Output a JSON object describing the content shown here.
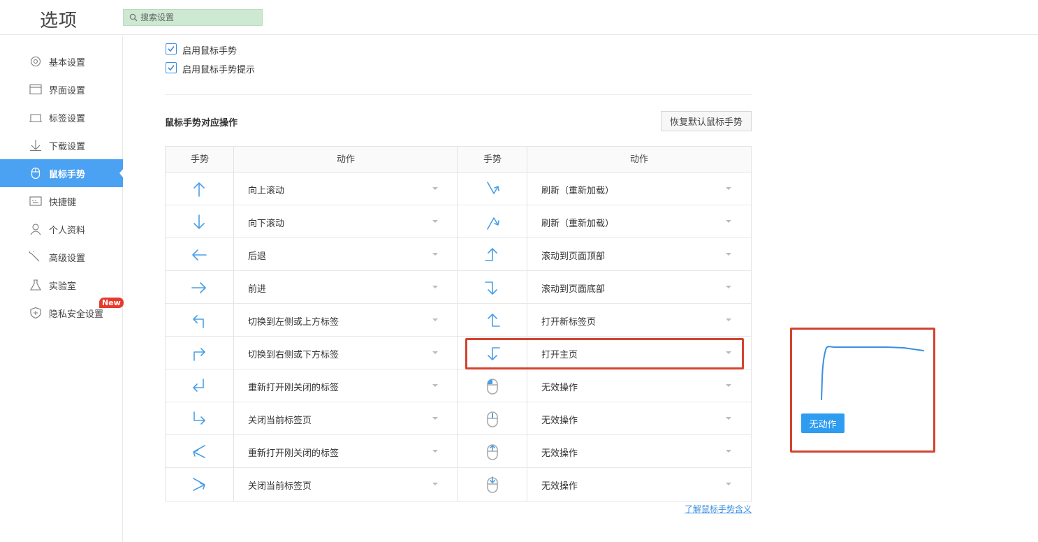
{
  "header": {
    "title": "选项",
    "search_placeholder": "搜索设置"
  },
  "sidebar": {
    "items": [
      {
        "label": "基本设置",
        "icon": "gear-icon"
      },
      {
        "label": "界面设置",
        "icon": "window-icon"
      },
      {
        "label": "标签设置",
        "icon": "tab-icon"
      },
      {
        "label": "下载设置",
        "icon": "download-icon"
      },
      {
        "label": "鼠标手势",
        "icon": "mouse-icon",
        "active": true
      },
      {
        "label": "快捷键",
        "icon": "keyboard-icon"
      },
      {
        "label": "个人资料",
        "icon": "user-icon"
      },
      {
        "label": "高级设置",
        "icon": "wrench-icon"
      },
      {
        "label": "实验室",
        "icon": "flask-icon"
      },
      {
        "label": "隐私安全设置",
        "icon": "shield-icon",
        "badge": "New"
      }
    ]
  },
  "options": {
    "enable_gesture": {
      "label": "启用鼠标手势",
      "checked": true
    },
    "enable_hint": {
      "label": "启用鼠标手势提示",
      "checked": true
    }
  },
  "section": {
    "title": "鼠标手势对应操作",
    "restore_button": "恢复默认鼠标手势"
  },
  "table": {
    "headers": {
      "gesture": "手势",
      "action": "动作"
    },
    "left": [
      {
        "icon": "arrow-up-icon",
        "action": "向上滚动"
      },
      {
        "icon": "arrow-down-icon",
        "action": "向下滚动"
      },
      {
        "icon": "arrow-left-icon",
        "action": "后退"
      },
      {
        "icon": "arrow-right-icon",
        "action": "前进"
      },
      {
        "icon": "up-left-gesture-icon",
        "action": "切换到左侧或上方标签"
      },
      {
        "icon": "up-right-gesture-icon",
        "action": "切换到右侧或下方标签"
      },
      {
        "icon": "down-left-gesture-icon",
        "action": "重新打开刚关闭的标签"
      },
      {
        "icon": "down-right-gesture-icon",
        "action": "关闭当前标签页"
      },
      {
        "icon": "right-left-gesture-icon",
        "action": "重新打开刚关闭的标签"
      },
      {
        "icon": "left-right-gesture-icon",
        "action": "关闭当前标签页"
      }
    ],
    "right": [
      {
        "icon": "down-up-zigzag-icon",
        "action": "刷新（重新加载）"
      },
      {
        "icon": "up-down-zigzag-icon",
        "action": "刷新（重新加载）"
      },
      {
        "icon": "right-up-gesture-icon",
        "action": "滚动到页面顶部"
      },
      {
        "icon": "right-down-gesture-icon",
        "action": "滚动到页面底部"
      },
      {
        "icon": "up-right-corner-icon",
        "action": "打开新标签页"
      },
      {
        "icon": "left-down-gesture-icon",
        "action": "打开主页",
        "highlighted": true
      },
      {
        "icon": "mouse-left-click-icon",
        "action": "无效操作"
      },
      {
        "icon": "mouse-middle-click-icon",
        "action": "无效操作"
      },
      {
        "icon": "mouse-scroll-up-icon",
        "action": "无效操作"
      },
      {
        "icon": "mouse-scroll-down-icon",
        "action": "无效操作"
      }
    ]
  },
  "learn_link": "了解鼠标手势含义",
  "preview": {
    "label": "无动作"
  },
  "colors": {
    "accent": "#4ba1f2",
    "icon": "#4a9fe8",
    "highlight": "#d4432f",
    "badge": "#e63a2e"
  }
}
